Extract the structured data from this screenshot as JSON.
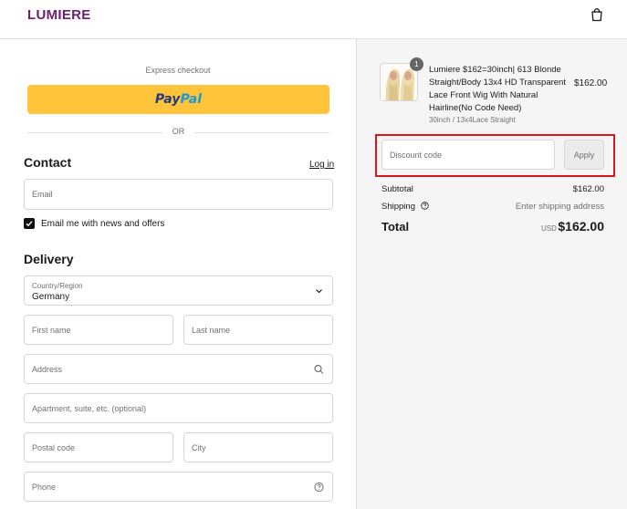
{
  "header": {
    "brand": "LUMIERE",
    "cart_icon": "shopping-bag-icon"
  },
  "express": {
    "label": "Express checkout",
    "paypal_part1": "Pay",
    "paypal_part2": "Pal",
    "or": "OR"
  },
  "contact": {
    "heading": "Contact",
    "login_link": "Log in",
    "email_placeholder": "Email",
    "newsletter_checked": true,
    "newsletter_label": "Email me with news and offers"
  },
  "delivery": {
    "heading": "Delivery",
    "country_label": "Country/Region",
    "country_value": "Germany",
    "first_name_placeholder": "First name",
    "last_name_placeholder": "Last name",
    "address_placeholder": "Address",
    "apartment_placeholder": "Apartment, suite, etc. (optional)",
    "postal_placeholder": "Postal code",
    "city_placeholder": "City",
    "phone_placeholder": "Phone"
  },
  "order": {
    "item": {
      "quantity": "1",
      "name": "Lumiere $162=30inch| 613 Blonde Straight/Body 13x4 HD Transparent Lace Front Wig With Natural Hairline(No Code Need)",
      "variant": "30inch / 13x4Lace Straight",
      "price": "$162.00"
    },
    "discount_placeholder": "Discount code",
    "apply_label": "Apply",
    "subtotal_label": "Subtotal",
    "subtotal_value": "$162.00",
    "shipping_label": "Shipping",
    "shipping_value": "Enter shipping address",
    "total_label": "Total",
    "total_currency": "USD",
    "total_value": "$162.00"
  },
  "colors": {
    "brand": "#6b1f6e",
    "paypal_yellow": "#ffc439",
    "highlight_red": "#d7191f"
  }
}
